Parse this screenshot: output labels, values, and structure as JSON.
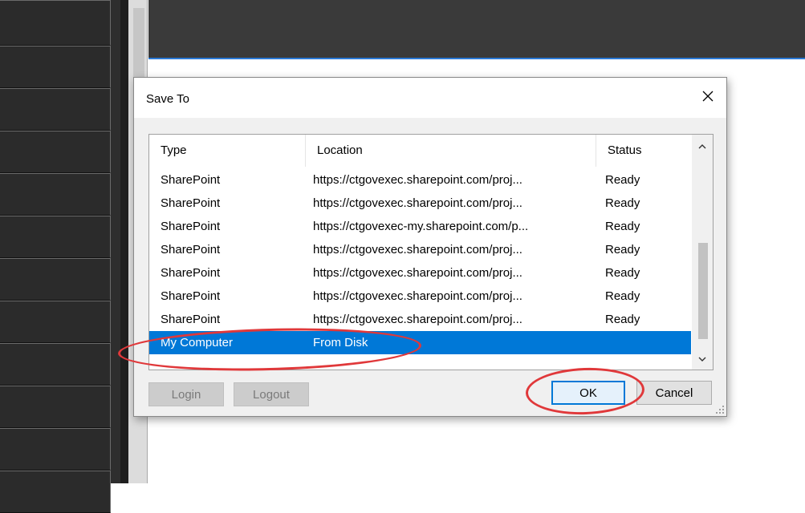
{
  "dialog": {
    "title": "Save To",
    "columns": [
      "Type",
      "Location",
      "Status"
    ],
    "rows": [
      {
        "type": "SharePoint",
        "location": "https://ctgovexec.sharepoint.com/proj...",
        "status": "Ready"
      },
      {
        "type": "SharePoint",
        "location": "https://ctgovexec.sharepoint.com/proj...",
        "status": "Ready"
      },
      {
        "type": "SharePoint",
        "location": "https://ctgovexec-my.sharepoint.com/p...",
        "status": "Ready"
      },
      {
        "type": "SharePoint",
        "location": "https://ctgovexec.sharepoint.com/proj...",
        "status": "Ready"
      },
      {
        "type": "SharePoint",
        "location": "https://ctgovexec.sharepoint.com/proj...",
        "status": "Ready"
      },
      {
        "type": "SharePoint",
        "location": "https://ctgovexec.sharepoint.com/proj...",
        "status": "Ready"
      },
      {
        "type": "SharePoint",
        "location": "https://ctgovexec.sharepoint.com/proj...",
        "status": "Ready"
      },
      {
        "type": "My Computer",
        "location": "From Disk",
        "status": "",
        "selected": true
      }
    ],
    "buttons": {
      "login": "Login",
      "logout": "Logout",
      "ok": "OK",
      "cancel": "Cancel"
    },
    "icons": {
      "close": "close-icon",
      "scroll_up": "chevron-up-icon",
      "scroll_down": "chevron-down-icon",
      "resize": "resize-grip-icon"
    }
  },
  "colors": {
    "selection": "#0078d7",
    "annotation": "#e0383a",
    "accent_line": "#2b7ad6"
  }
}
